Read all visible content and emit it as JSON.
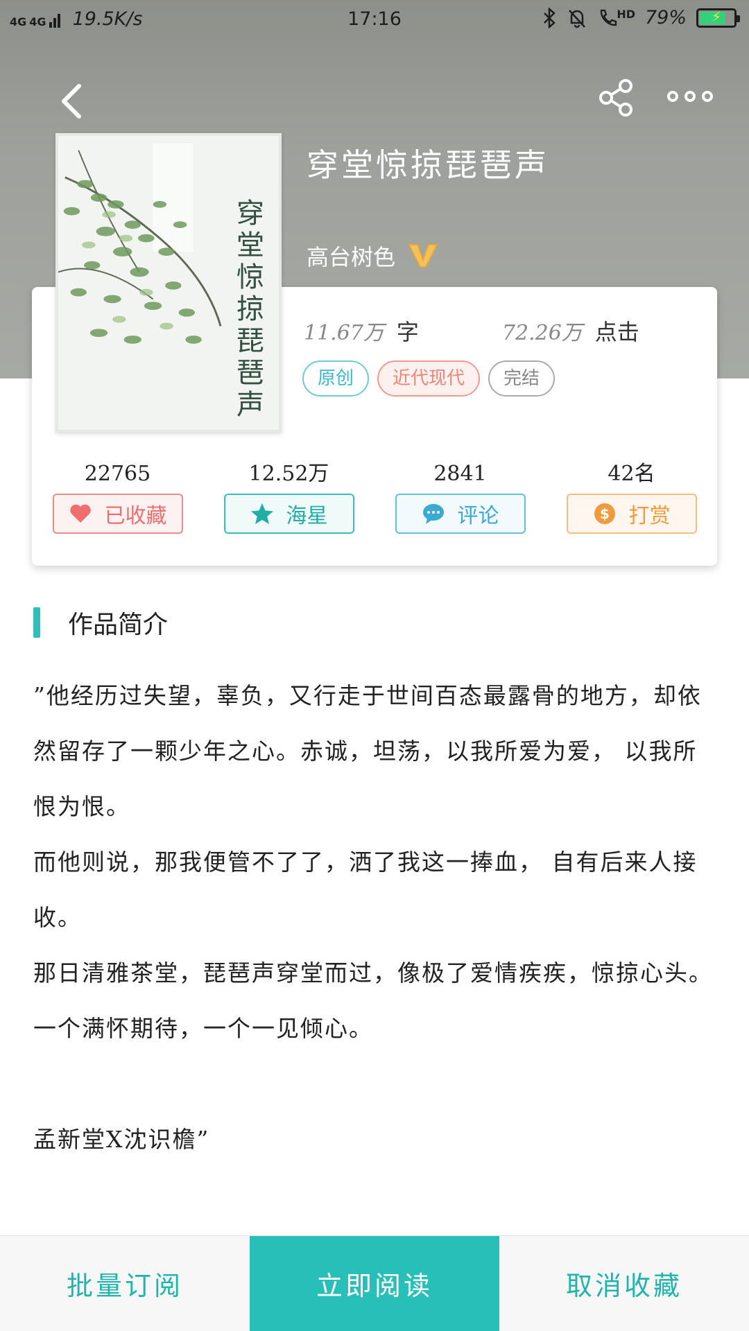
{
  "status_bar": {
    "network": "4G",
    "speed": "19.5K/s",
    "time": "17:16",
    "hd": "HD",
    "battery": "79%",
    "battery_level": 0.79
  },
  "book": {
    "title": "穿堂惊掠琵琶声",
    "author": "高台树色",
    "cover_title": "穿堂惊掠琵琶声",
    "word_count": "11.67万",
    "word_unit": "字",
    "clicks": "72.26万",
    "click_unit": "点击",
    "tags": [
      "原创",
      "近代现代",
      "完结"
    ]
  },
  "actions": [
    {
      "count": "22765",
      "label": "已收藏",
      "icon": "heart-icon"
    },
    {
      "count": "12.52万",
      "label": "海星",
      "icon": "star-icon"
    },
    {
      "count": "2841",
      "label": "评论",
      "icon": "comment-icon"
    },
    {
      "count": "42名",
      "label": "打赏",
      "icon": "coin-icon"
    }
  ],
  "intro": {
    "heading": "作品简介",
    "paragraphs": [
      "”他经历过失望，辜负，又行走于世间百态最露骨的地方，却依然留存了一颗少年之心。赤诚，坦荡，以我所爱为爱， 以我所恨为恨。",
      "而他则说，那我便管不了了，洒了我这一捧血， 自有后来人接收。",
      "那日清雅茶堂，琵琶声穿堂而过，像极了爱情疾疾，惊掠心头。",
      "一个满怀期待，一个一见倾心。",
      "",
      "孟新堂X沈识檐”"
    ]
  },
  "bottom_bar": {
    "batch": "批量订阅",
    "read": "立即阅读",
    "cancel": "取消收藏"
  },
  "colors": {
    "accent": "#28bfb8",
    "hero_bg": "#9ea19b"
  }
}
